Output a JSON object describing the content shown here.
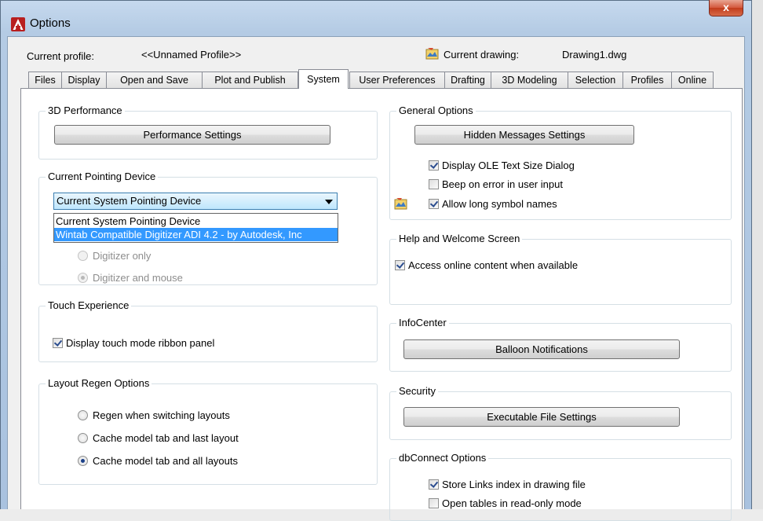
{
  "window": {
    "title": "Options",
    "close_glyph": "x"
  },
  "header": {
    "current_profile_label": "Current profile:",
    "current_profile_value": "<<Unnamed Profile>>",
    "current_drawing_label": "Current drawing:",
    "current_drawing_value": "Drawing1.dwg"
  },
  "tabs": [
    {
      "label": "Files"
    },
    {
      "label": "Display"
    },
    {
      "label": "Open and Save"
    },
    {
      "label": "Plot and Publish"
    },
    {
      "label": "System",
      "active": true
    },
    {
      "label": "User Preferences"
    },
    {
      "label": "Drafting"
    },
    {
      "label": "3D Modeling"
    },
    {
      "label": "Selection"
    },
    {
      "label": "Profiles"
    },
    {
      "label": "Online"
    }
  ],
  "performance": {
    "title": "3D Performance",
    "button": "Performance Settings"
  },
  "pointing": {
    "title": "Current Pointing Device",
    "selected": "Current System Pointing Device",
    "options": [
      "Current System Pointing Device",
      "Wintab Compatible Digitizer ADI 4.2 - by Autodesk, Inc"
    ],
    "radio_digitizer_only": "Digitizer only",
    "radio_digitizer_mouse": "Digitizer and mouse"
  },
  "touch": {
    "title": "Touch Experience",
    "checkbox": "Display touch mode ribbon panel"
  },
  "layout_regen": {
    "title": "Layout Regen Options",
    "options": [
      "Regen when switching layouts",
      "Cache model tab and last layout",
      "Cache model tab and all layouts"
    ],
    "selected_index": 2
  },
  "general": {
    "title": "General Options",
    "button": "Hidden Messages Settings",
    "checkbox_ole": "Display OLE Text Size Dialog",
    "checkbox_beep": "Beep on error in user input",
    "checkbox_symbol": "Allow long symbol names"
  },
  "help": {
    "title": "Help and Welcome Screen",
    "checkbox": "Access online content when available"
  },
  "infocenter": {
    "title": "InfoCenter",
    "button": "Balloon Notifications"
  },
  "security": {
    "title": "Security",
    "button": "Executable File Settings"
  },
  "dbconnect": {
    "title": "dbConnect Options",
    "checkbox_links": "Store Links index in drawing file",
    "checkbox_readonly": "Open tables in read-only mode"
  },
  "colors": {
    "accent_selection": "#3399ff",
    "title_bar": "#b9cfe7",
    "close_button": "#c9442a"
  }
}
